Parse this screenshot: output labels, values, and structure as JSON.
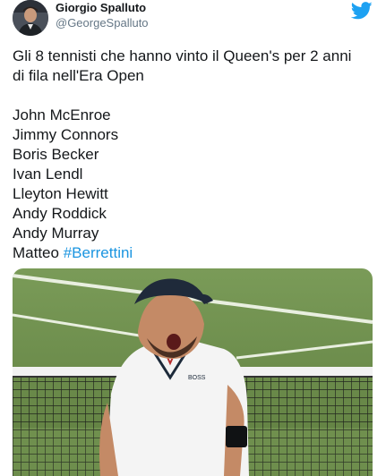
{
  "author": {
    "name": "Giorgio Spalluto",
    "handle": "@GeorgeSpalluto"
  },
  "tweet": {
    "text_lines": [
      "Gli 8 tennisti che hanno vinto il Queen's per 2 anni",
      "di fila nell'Era Open"
    ],
    "players": [
      "John McEnroe",
      "Jimmy Connors",
      "Boris Becker",
      "Ivan Lendl",
      "Lleyton Hewitt",
      "Andy Roddick",
      "Andy Murray"
    ],
    "last_line_prefix": "Matteo",
    "hashtag": "#Berrettini"
  },
  "photo": {
    "shirt_logo": "BOSS"
  },
  "icons": {
    "brand": "twitter-bird-icon"
  },
  "colors": {
    "link": "#1b95e0",
    "twitter_blue": "#1da1f2",
    "text": "#14171a",
    "secondary": "#657786"
  }
}
